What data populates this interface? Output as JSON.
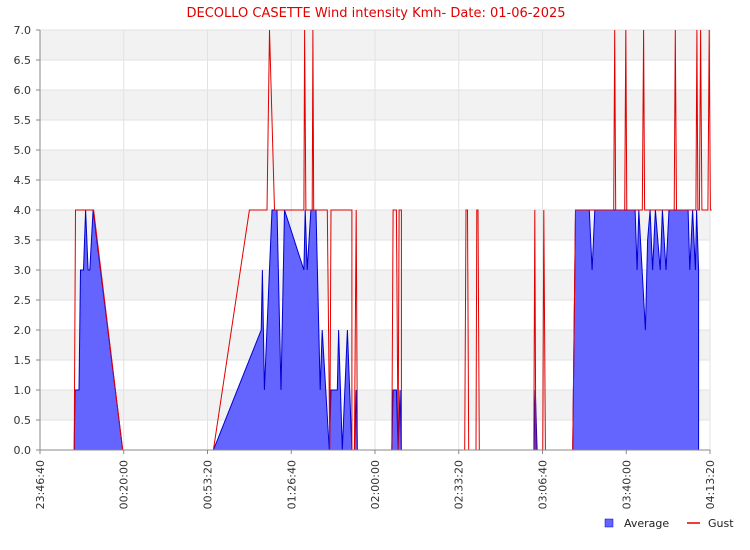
{
  "chart_data": {
    "type": "area",
    "title": "DECOLLO CASETTE Wind intensity Kmh- Date: 01-06-2025",
    "xlabel": "",
    "ylabel": "",
    "ylim": [
      0,
      7
    ],
    "y_ticks": [
      "0.0",
      "0.5",
      "1.0",
      "1.5",
      "2.0",
      "2.5",
      "3.0",
      "3.5",
      "4.0",
      "4.5",
      "5.0",
      "5.5",
      "6.0",
      "6.5",
      "7.0"
    ],
    "x_range_minutes": [
      -13.33,
      253.33
    ],
    "x_ticks": [
      {
        "label": "23:46:40",
        "minutes": -13.33
      },
      {
        "label": "00:20:00",
        "minutes": 20
      },
      {
        "label": "00:53:20",
        "minutes": 53.33
      },
      {
        "label": "01:26:40",
        "minutes": 86.67
      },
      {
        "label": "02:00:00",
        "minutes": 120
      },
      {
        "label": "02:33:20",
        "minutes": 153.33
      },
      {
        "label": "03:06:40",
        "minutes": 186.67
      },
      {
        "label": "03:40:00",
        "minutes": 220
      },
      {
        "label": "04:13:20",
        "minutes": 253.33
      }
    ],
    "grid": true,
    "legend_position": "bottom-right",
    "colors": {
      "average": "#6464ff",
      "average_line": "#0000d0",
      "gust": "#e00000",
      "band": "#f2f2f2"
    },
    "series": [
      {
        "name": "Average",
        "type": "area",
        "segments": [
          [
            [
              0.3,
              0
            ],
            [
              0.6,
              1
            ],
            [
              2.2,
              1
            ],
            [
              2.8,
              3
            ],
            [
              4.0,
              3
            ],
            [
              4.8,
              4
            ],
            [
              5.8,
              3
            ],
            [
              6.5,
              3
            ],
            [
              7.8,
              4
            ],
            [
              19.6,
              0
            ]
          ],
          [
            [
              55.7,
              0
            ],
            [
              74.7,
              2
            ],
            [
              75.2,
              3
            ],
            [
              76.0,
              1
            ],
            [
              79.0,
              4
            ],
            [
              81.0,
              4
            ],
            [
              82.6,
              1
            ],
            [
              84.0,
              4
            ],
            [
              91.7,
              3
            ],
            [
              92.2,
              4
            ],
            [
              93.0,
              3
            ],
            [
              94.5,
              4
            ],
            [
              96.5,
              4
            ],
            [
              98.2,
              1
            ],
            [
              99.0,
              2
            ],
            [
              101.8,
              0
            ],
            [
              102.5,
              1
            ],
            [
              105.0,
              1
            ],
            [
              105.5,
              2
            ],
            [
              107.0,
              0
            ],
            [
              109.0,
              2
            ],
            [
              110.8,
              0
            ]
          ],
          [
            [
              111.8,
              0
            ],
            [
              112.5,
              1
            ],
            [
              113.0,
              0
            ]
          ],
          [
            [
              126.7,
              0
            ],
            [
              127.2,
              1
            ],
            [
              128.5,
              1
            ],
            [
              129.2,
              0
            ],
            [
              130.0,
              1
            ],
            [
              130.5,
              0
            ]
          ],
          [
            [
              183.3,
              0
            ],
            [
              183.8,
              1
            ],
            [
              184.5,
              0
            ]
          ],
          [
            [
              198.7,
              0
            ],
            [
              199.8,
              4
            ],
            [
              205.3,
              4
            ],
            [
              206.4,
              3
            ],
            [
              207.5,
              4
            ],
            [
              223.5,
              4
            ],
            [
              224.3,
              3
            ],
            [
              225.0,
              4
            ],
            [
              227.6,
              2
            ],
            [
              228.5,
              3.5
            ],
            [
              229.5,
              4
            ],
            [
              230.5,
              3
            ],
            [
              231.6,
              4
            ],
            [
              233.5,
              3
            ],
            [
              234.4,
              4
            ],
            [
              235.8,
              3
            ],
            [
              237.0,
              4
            ],
            [
              244.6,
              4
            ],
            [
              245.3,
              3
            ],
            [
              246.4,
              4
            ],
            [
              247.5,
              3
            ],
            [
              248.0,
              4
            ],
            [
              248.8,
              3
            ],
            [
              248.8,
              0
            ]
          ]
        ]
      },
      {
        "name": "Gust",
        "type": "line",
        "segments": [
          [
            [
              0.3,
              0
            ],
            [
              0.8,
              4
            ],
            [
              8.0,
              4
            ],
            [
              19.6,
              0
            ]
          ],
          [
            [
              55.7,
              0
            ],
            [
              70.0,
              4
            ],
            [
              77.0,
              4
            ],
            [
              78.0,
              7
            ],
            [
              80.0,
              4
            ],
            [
              91.7,
              4
            ],
            [
              92.0,
              7
            ],
            [
              92.5,
              4
            ],
            [
              95.0,
              4
            ],
            [
              95.3,
              7
            ],
            [
              95.6,
              4
            ],
            [
              101.0,
              4
            ],
            [
              102.0,
              0
            ],
            [
              102.5,
              4
            ],
            [
              110.8,
              4
            ],
            [
              110.8,
              0
            ]
          ],
          [
            [
              111.8,
              0
            ],
            [
              112.5,
              4
            ],
            [
              113.0,
              0
            ]
          ],
          [
            [
              126.7,
              0
            ],
            [
              127.2,
              4
            ],
            [
              128.5,
              4
            ],
            [
              129.2,
              0
            ],
            [
              129.6,
              4
            ],
            [
              130.5,
              4
            ],
            [
              130.5,
              0
            ]
          ],
          [
            [
              155.7,
              0
            ],
            [
              156.2,
              4
            ],
            [
              156.8,
              4
            ],
            [
              157.3,
              0
            ]
          ],
          [
            [
              160.2,
              0
            ],
            [
              160.5,
              4
            ],
            [
              161.0,
              4
            ],
            [
              161.5,
              0
            ]
          ],
          [
            [
              183.2,
              0
            ],
            [
              183.6,
              4
            ],
            [
              184.0,
              0
            ]
          ],
          [
            [
              186.8,
              0
            ],
            [
              187.2,
              4
            ],
            [
              187.8,
              0
            ]
          ],
          [
            [
              198.7,
              0
            ],
            [
              199.8,
              4
            ],
            [
              215.0,
              4
            ],
            [
              215.4,
              7
            ],
            [
              215.8,
              4
            ],
            [
              219.4,
              4
            ],
            [
              219.8,
              7
            ],
            [
              220.2,
              4
            ],
            [
              226.4,
              4
            ],
            [
              226.9,
              7
            ],
            [
              227.3,
              4
            ],
            [
              239.1,
              4
            ],
            [
              239.5,
              7
            ],
            [
              240.0,
              4
            ],
            [
              247.7,
              4
            ],
            [
              248.1,
              7
            ],
            [
              248.5,
              4
            ],
            [
              249.1,
              4
            ],
            [
              249.6,
              7
            ],
            [
              250.1,
              4
            ],
            [
              252.5,
              4
            ],
            [
              253.0,
              7
            ],
            [
              253.5,
              4
            ],
            [
              254.0,
              4
            ]
          ]
        ]
      }
    ]
  }
}
